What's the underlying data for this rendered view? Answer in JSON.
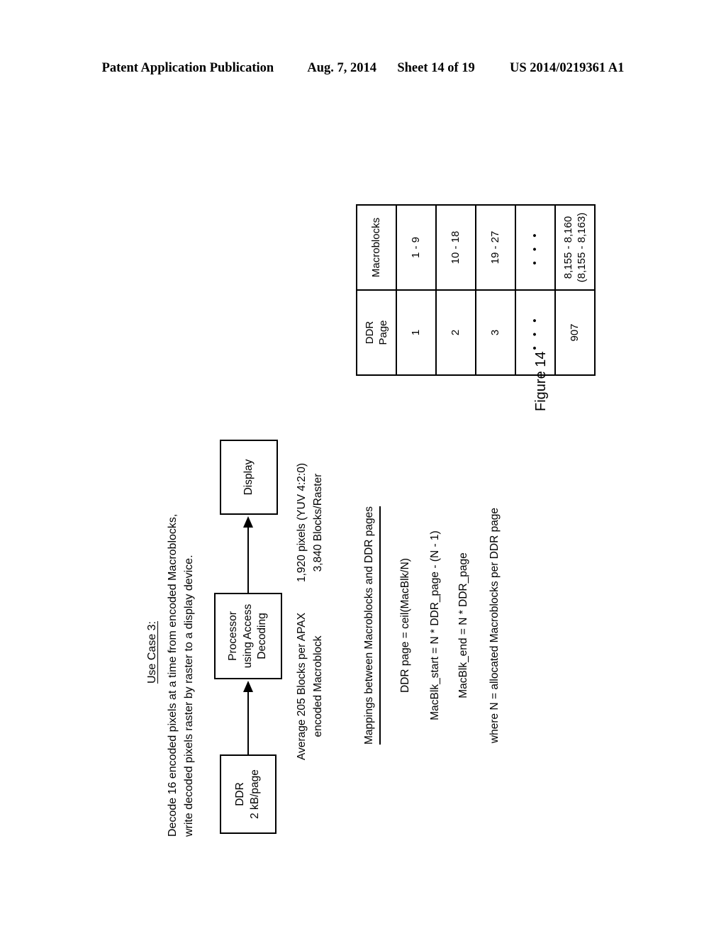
{
  "header": {
    "publication": "Patent Application Publication",
    "date": "Aug. 7, 2014",
    "sheet": "Sheet 14 of 19",
    "number": "US 2014/0219361 A1"
  },
  "figure": {
    "caption": "Figure 14",
    "use_case": {
      "title": "Use Case 3:",
      "line1": "Decode 16 encoded pixels at a time from encoded Macroblocks,",
      "line2": "write decoded pixels raster by raster to a display device."
    },
    "flow": {
      "ddr": {
        "line1": "DDR",
        "line2": "2 kB/page"
      },
      "processor": {
        "line1": "Processor",
        "line2": "using Access",
        "line3": "Decoding"
      },
      "display": {
        "line1": "Display"
      }
    },
    "annotations": {
      "ddr_to_processor": {
        "line1": "Average 205 Blocks per APAX",
        "line2": "encoded Macroblock"
      },
      "processor_to_display": {
        "line1": "1,920 pixels (YUV 4:2:0)",
        "line2": "3,840 Blocks/Raster"
      }
    },
    "mappings": {
      "title": "Mappings between Macroblocks and DDR pages",
      "equations": [
        "DDR page = ceil(MacBlk/N)",
        "MacBlk_start = N * DDR_page - (N - 1)",
        "MacBlk_end = N * DDR_page"
      ],
      "note": "where N = allocated Macroblocks per DDR page"
    },
    "table": {
      "headers": [
        "DDR Page",
        "Macroblocks"
      ],
      "header_ddr_line1": "DDR",
      "header_ddr_line2": "Page",
      "header_macroblocks": "Macroblocks",
      "rows": [
        {
          "ddr_page": "1",
          "macroblocks": "1 - 9"
        },
        {
          "ddr_page": "2",
          "macroblocks": "10 - 18"
        },
        {
          "ddr_page": "3",
          "macroblocks": "19 - 27"
        },
        {
          "ddr_page": "• • •",
          "macroblocks": "• • •"
        },
        {
          "ddr_page": "907",
          "macroblocks_line1": "8,155 - 8,160",
          "macroblocks_line2": "(8,155 - 8,163)"
        }
      ]
    }
  }
}
